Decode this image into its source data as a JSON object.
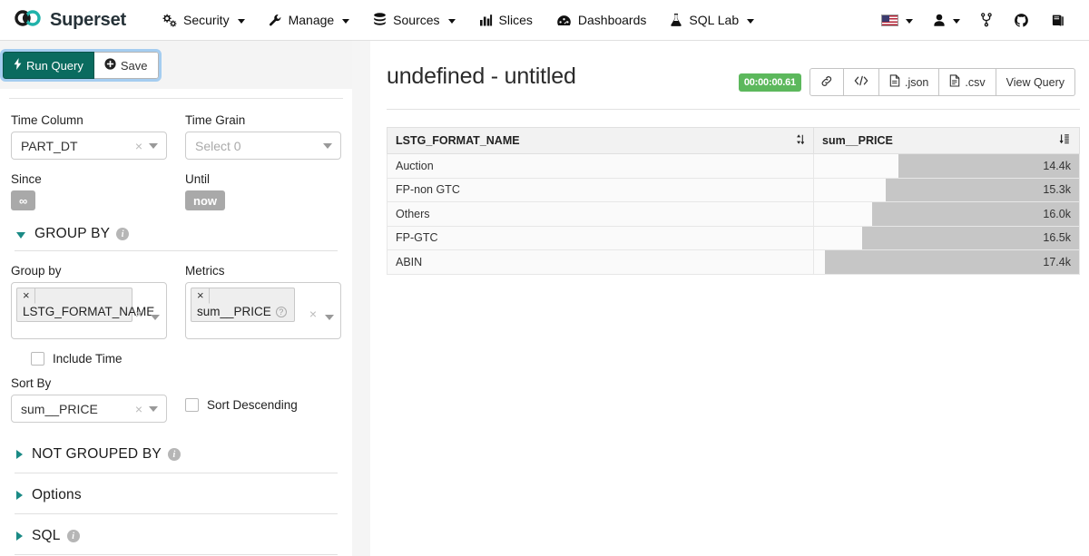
{
  "navbar": {
    "brand": "Superset",
    "brand_logo_icon": "infinity-loop-icon",
    "items": [
      {
        "label": "Security",
        "icon": "gears-icon",
        "has_caret": true
      },
      {
        "label": "Manage",
        "icon": "wrench-icon",
        "has_caret": true
      },
      {
        "label": "Sources",
        "icon": "database-icon",
        "has_caret": true
      },
      {
        "label": "Slices",
        "icon": "bar-chart-icon",
        "has_caret": false
      },
      {
        "label": "Dashboards",
        "icon": "dashboard-gauge-icon",
        "has_caret": false
      },
      {
        "label": "SQL Lab",
        "icon": "flask-icon",
        "has_caret": true
      }
    ],
    "right_items": [
      {
        "name": "language-picker",
        "icon": "us-flag-icon",
        "has_caret": true
      },
      {
        "name": "user-menu",
        "icon": "user-icon",
        "has_caret": true
      },
      {
        "name": "version-branch",
        "icon": "code-fork-icon",
        "has_caret": false
      },
      {
        "name": "github-link",
        "icon": "github-icon",
        "has_caret": false
      },
      {
        "name": "docs-link",
        "icon": "book-icon",
        "has_caret": false
      }
    ]
  },
  "toolbar": {
    "run_query_label": "Run Query",
    "run_query_icon": "lightning-bolt-icon",
    "save_label": "Save",
    "save_icon": "plus-circle-icon",
    "run_query_color": "#0a6b5f"
  },
  "controls": {
    "time_column": {
      "label": "Time Column",
      "value": "PART_DT"
    },
    "time_grain": {
      "label": "Time Grain",
      "placeholder": "Select 0",
      "value": ""
    },
    "since": {
      "label": "Since",
      "value": "∞"
    },
    "until": {
      "label": "Until",
      "value": "now"
    },
    "group_by_section": {
      "title": "GROUP BY",
      "expanded": true,
      "has_info": true
    },
    "group_by": {
      "label": "Group by",
      "tokens": [
        "LSTG_FORMAT_NAME"
      ]
    },
    "metrics": {
      "label": "Metrics",
      "tokens": [
        "sum__PRICE"
      ]
    },
    "include_time": {
      "label": "Include Time",
      "checked": false
    },
    "sort_by": {
      "label": "Sort By",
      "value": "sum__PRICE"
    },
    "sort_descending": {
      "label": "Sort Descending",
      "checked": false
    },
    "sections": [
      {
        "title": "NOT GROUPED BY",
        "expanded": false,
        "has_info": true
      },
      {
        "title": "Options",
        "expanded": false,
        "has_info": false
      },
      {
        "title": "SQL",
        "expanded": false,
        "has_info": true
      }
    ]
  },
  "chart": {
    "title": "undefined - untitled",
    "timer": "00:00:00.61",
    "timer_color": "#5cb85c",
    "actions": [
      {
        "label": "",
        "icon": "link-chain-icon",
        "name": "share-link-button"
      },
      {
        "label": "",
        "icon": "code-brackets-icon",
        "name": "embed-code-button"
      },
      {
        "label": ".json",
        "icon": "file-json-icon",
        "name": "export-json-button"
      },
      {
        "label": ".csv",
        "icon": "file-csv-icon",
        "name": "export-csv-button"
      },
      {
        "label": "View Query",
        "icon": "",
        "name": "view-query-button"
      }
    ]
  },
  "chart_data": {
    "type": "table",
    "title": "undefined - untitled",
    "columns": [
      {
        "key": "LSTG_FORMAT_NAME",
        "label": "LSTG_FORMAT_NAME",
        "sort_icon": "sort-both-icon",
        "align": "left"
      },
      {
        "key": "sum__PRICE",
        "label": "sum__PRICE",
        "sort_icon": "sort-numeric-desc-icon",
        "align": "right"
      }
    ],
    "categories": [
      "Auction",
      "FP-non GTC",
      "Others",
      "FP-GTC",
      "ABIN"
    ],
    "values": [
      14400,
      15300,
      16000,
      16500,
      17400
    ],
    "value_labels": [
      "14.4k",
      "15.3k",
      "16.0k",
      "16.5k",
      "17.4k"
    ],
    "bar_percent": [
      68,
      73,
      78,
      82,
      96
    ],
    "bar_color": "#c6c6c6",
    "rows": [
      {
        "name": "Auction",
        "value": "14.4k",
        "pct": 68
      },
      {
        "name": "FP-non GTC",
        "value": "15.3k",
        "pct": 73
      },
      {
        "name": "Others",
        "value": "16.0k",
        "pct": 78
      },
      {
        "name": "FP-GTC",
        "value": "16.5k",
        "pct": 82
      },
      {
        "name": "ABIN",
        "value": "17.4k",
        "pct": 96
      }
    ],
    "xlabel": "",
    "ylabel": "",
    "legend": "none"
  }
}
